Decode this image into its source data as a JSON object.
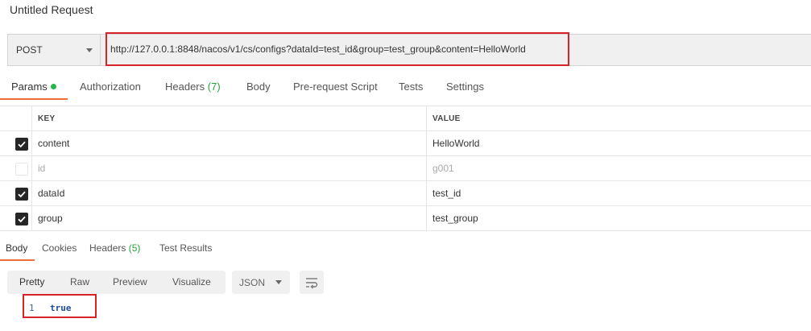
{
  "title": "Untitled Request",
  "request": {
    "method": "POST",
    "url": "http://127.0.0.1:8848/nacos/v1/cs/configs?dataId=test_id&group=test_group&content=HelloWorld"
  },
  "tabs": {
    "params": "Params",
    "authorization": "Authorization",
    "headers": "Headers",
    "headers_count": "(7)",
    "body": "Body",
    "prerequest": "Pre-request Script",
    "tests": "Tests",
    "settings": "Settings"
  },
  "params": {
    "key_header": "KEY",
    "value_header": "VALUE",
    "rows": [
      {
        "key": "content",
        "value": "HelloWorld",
        "checked": true
      },
      {
        "key": "id",
        "value": "g001",
        "checked": false
      },
      {
        "key": "dataId",
        "value": "test_id",
        "checked": true
      },
      {
        "key": "group",
        "value": "test_group",
        "checked": true
      }
    ]
  },
  "response_tabs": {
    "body": "Body",
    "cookies": "Cookies",
    "headers": "Headers",
    "headers_count": "(5)",
    "test_results": "Test Results"
  },
  "view": {
    "pretty": "Pretty",
    "raw": "Raw",
    "preview": "Preview",
    "visualize": "Visualize",
    "format": "JSON"
  },
  "response": {
    "line_number": "1",
    "content": "true"
  },
  "colors": {
    "accent": "#f26b3a",
    "highlight_box": "#d9232a",
    "count_green": "#25a340"
  }
}
